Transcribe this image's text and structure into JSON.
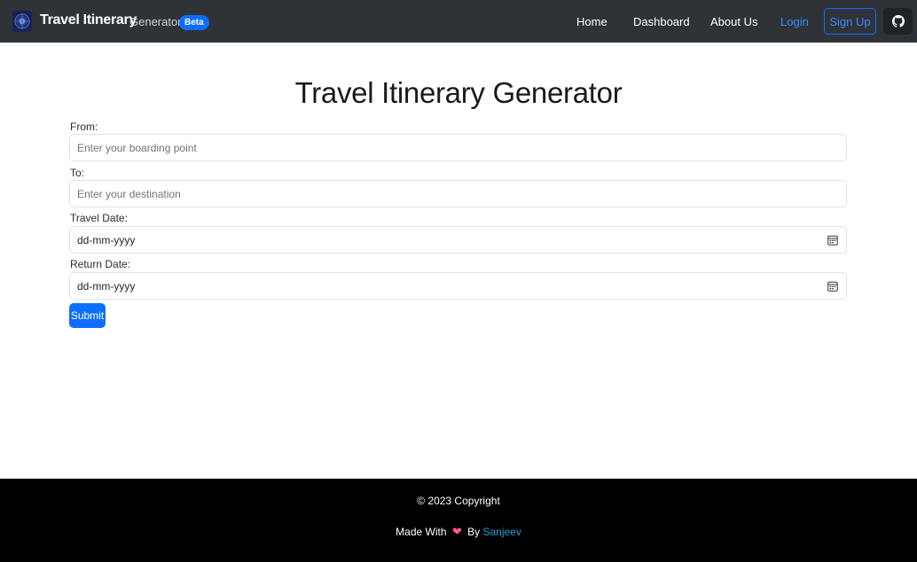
{
  "navbar": {
    "brand_title": "Travel Itinerary",
    "brand_subtitle": "Generator",
    "badge": "Beta",
    "links": {
      "home": "Home",
      "dashboard": "Dashboard",
      "about": "About Us",
      "login": "Login"
    },
    "signup_label": "Sign Up",
    "github_icon": "github-icon"
  },
  "main": {
    "title": "Travel Itinerary Generator",
    "from": {
      "label": "From:",
      "placeholder": "Enter your boarding point",
      "value": ""
    },
    "to": {
      "label": "To:",
      "placeholder": "Enter your destination",
      "value": ""
    },
    "travel_date": {
      "label": "Travel Date:",
      "value": "dd-mm-yyyy"
    },
    "return_date": {
      "label": "Return Date:",
      "value": "dd-mm-yyyy"
    },
    "submit_label": "Submit"
  },
  "footer": {
    "copyright": "© 2023 Copyright",
    "made_with": "Made With",
    "heart_icon": "heart-icon",
    "by": "By",
    "author": "Sanjeev"
  },
  "colors": {
    "navbar_bg": "#2f3338",
    "primary": "#0d6efd",
    "footer_bg": "#000000",
    "heart": "#ff5c8a",
    "author_link": "#1fa2d8"
  }
}
